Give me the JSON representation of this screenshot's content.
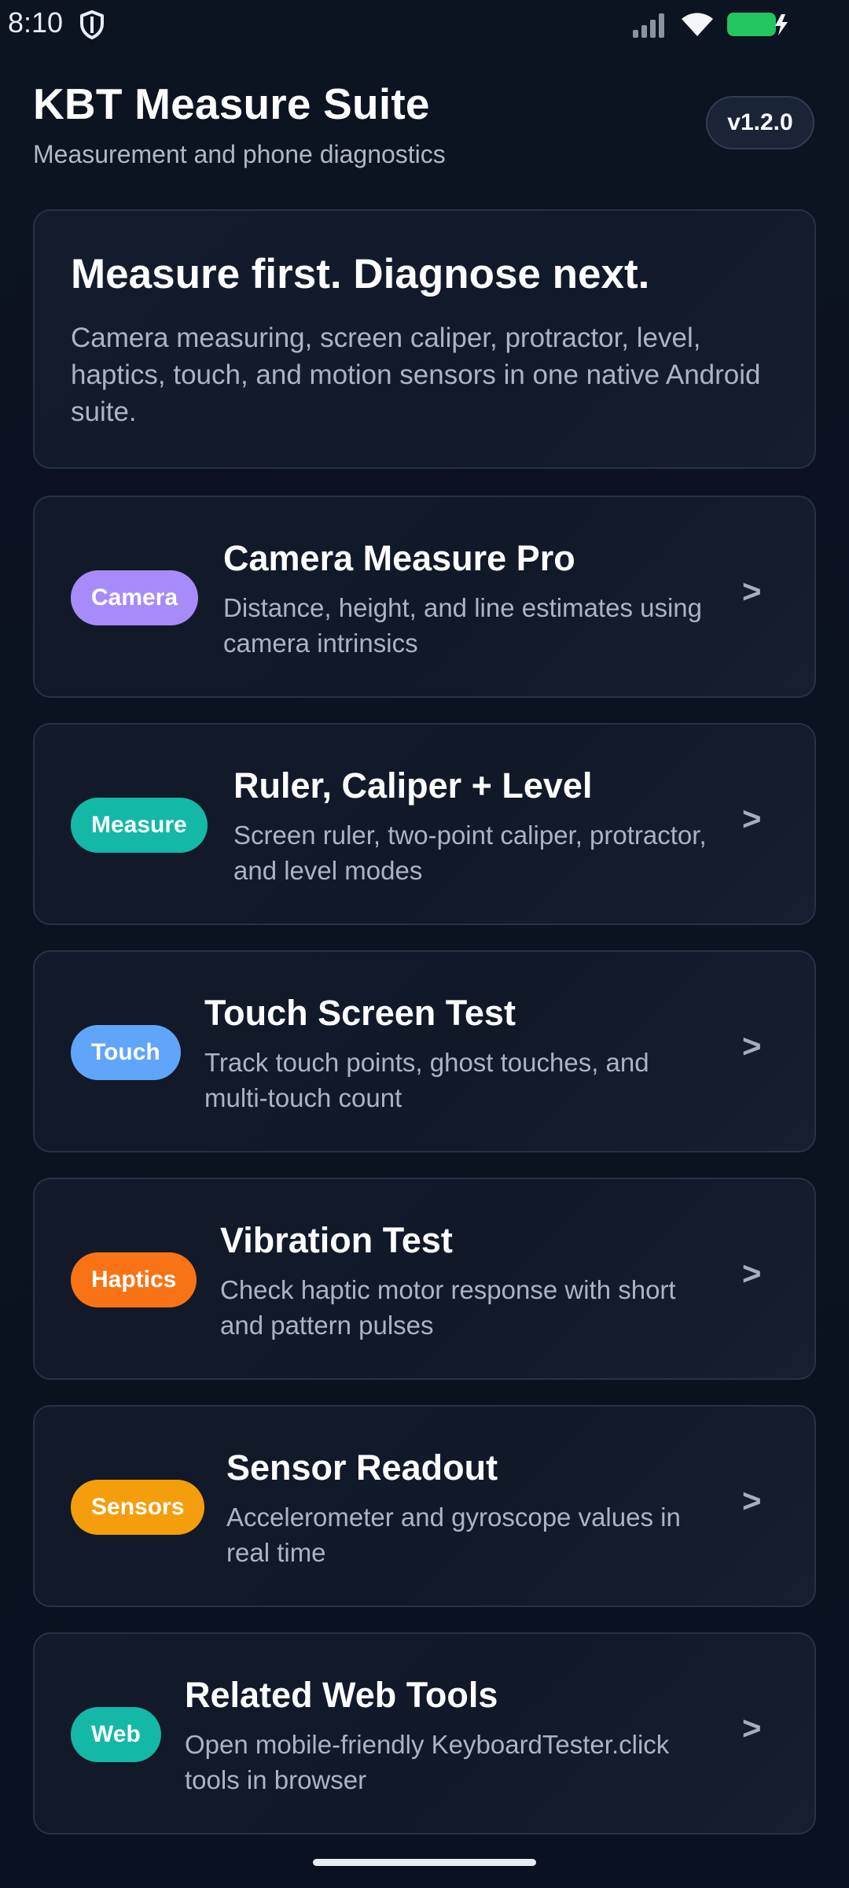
{
  "status_bar": {
    "time": "8:10",
    "icons": [
      "shield-icon",
      "cell-signal-icon",
      "wifi-icon",
      "battery-charging-icon"
    ],
    "battery_color": "#22c55e"
  },
  "header": {
    "title": "KBT Measure Suite",
    "subtitle": "Measurement and phone diagnostics",
    "version": "v1.2.0"
  },
  "hero": {
    "title": "Measure first. Diagnose next.",
    "text": "Camera measuring, screen caliper, protractor, level, haptics, touch, and motion sensors in one native Android suite."
  },
  "tools": [
    {
      "badge": "Camera",
      "badge_color": "#a78bfa",
      "title": "Camera Measure Pro",
      "description": "Distance, height, and line estimates using camera intrinsics",
      "chevron": ">"
    },
    {
      "badge": "Measure",
      "badge_color": "#14b8a6",
      "title": "Ruler, Caliper + Level",
      "description": "Screen ruler, two-point caliper, protractor, and level modes",
      "chevron": ">"
    },
    {
      "badge": "Touch",
      "badge_color": "#60a5fa",
      "title": "Touch Screen Test",
      "description": "Track touch points, ghost touches, and multi-touch count",
      "chevron": ">"
    },
    {
      "badge": "Haptics",
      "badge_color": "#f97316",
      "title": "Vibration Test",
      "description": "Check haptic motor response with short and pattern pulses",
      "chevron": ">"
    },
    {
      "badge": "Sensors",
      "badge_color": "#f59e0b",
      "title": "Sensor Readout",
      "description": "Accelerometer and gyroscope values in real time",
      "chevron": ">"
    },
    {
      "badge": "Web",
      "badge_color": "#14b8a6",
      "title": "Related Web Tools",
      "description": "Open mobile-friendly KeyboardTester.click tools in browser",
      "chevron": ">"
    }
  ]
}
